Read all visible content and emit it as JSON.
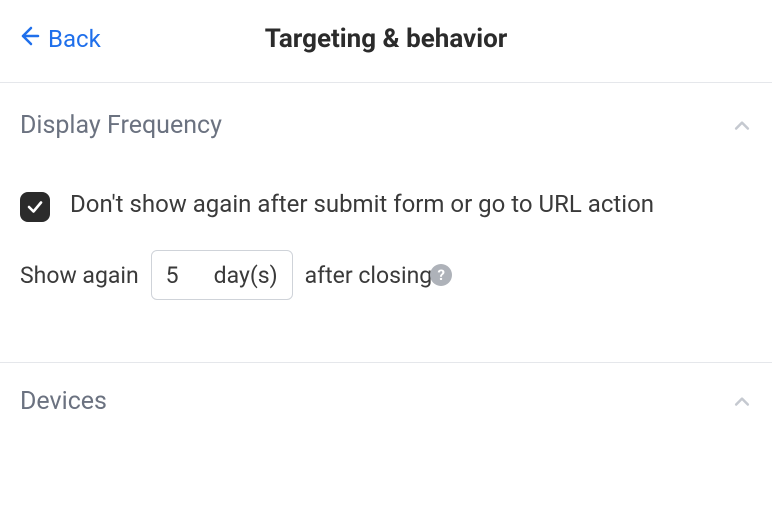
{
  "header": {
    "back_label": "Back",
    "title": "Targeting & behavior"
  },
  "sections": {
    "display_frequency": {
      "title": "Display Frequency",
      "checkbox_label": "Don't show again after submit form or go to URL action",
      "show_again_prefix": "Show again",
      "show_again_value": "5",
      "show_again_unit": "day(s)",
      "show_again_suffix": "after closing"
    },
    "devices": {
      "title": "Devices"
    }
  }
}
